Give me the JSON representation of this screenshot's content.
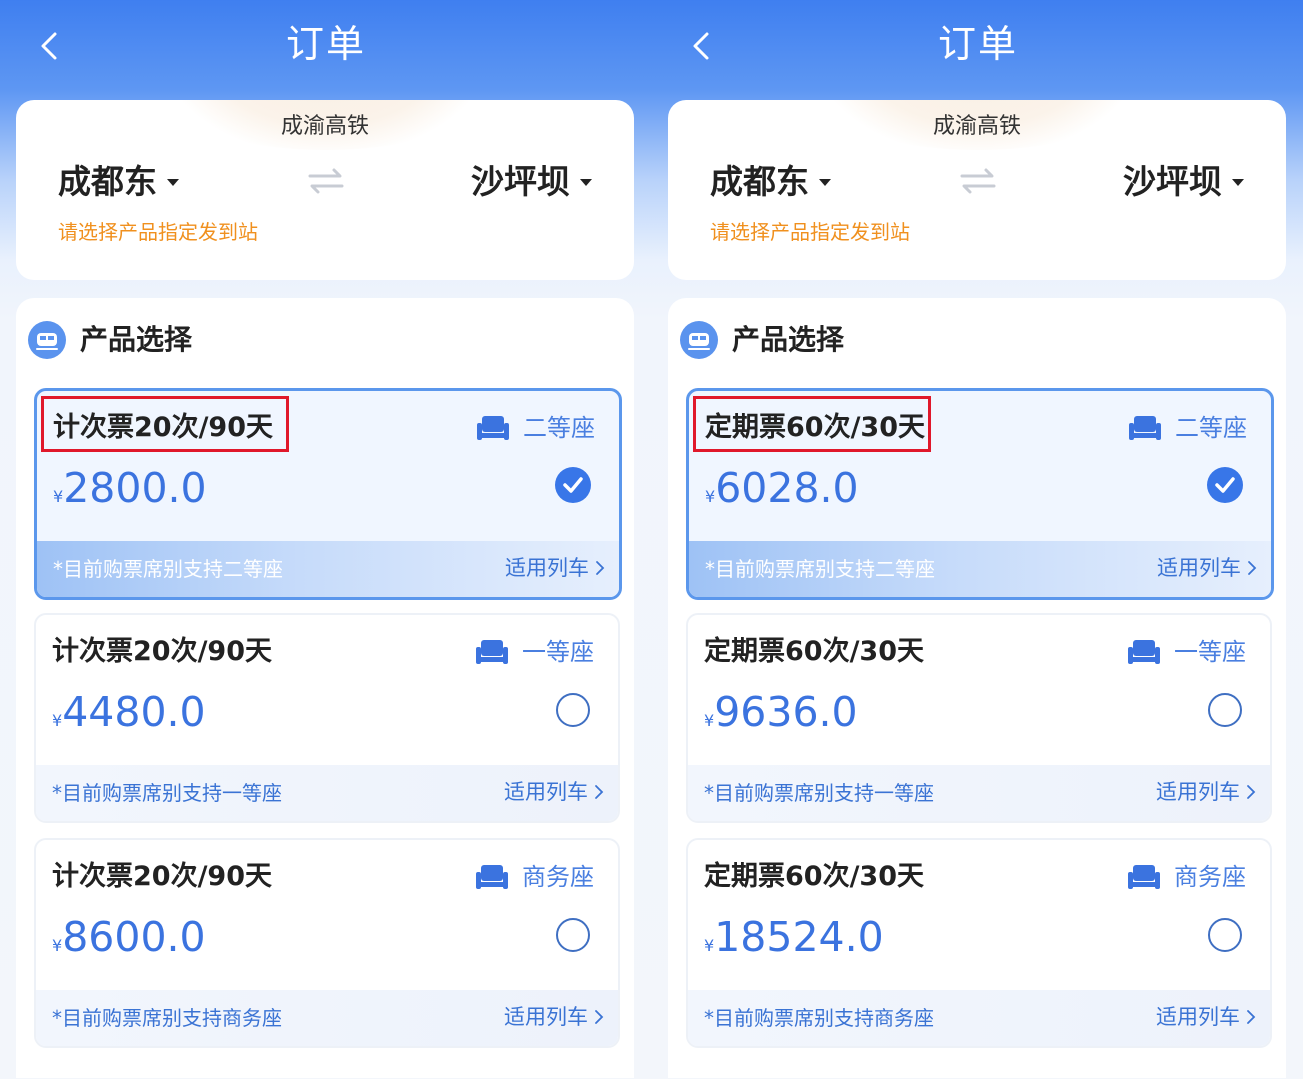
{
  "screens": [
    {
      "nav": {
        "title": "订单"
      },
      "route": {
        "line_name": "成渝高铁",
        "from_station": "成都东",
        "to_station": "沙坪坝",
        "hint": "请选择产品指定发到站"
      },
      "products": {
        "section_title": "产品选择",
        "options": [
          {
            "name": "计次票20次/90天",
            "seat": "二等座",
            "currency": "¥",
            "price": "2800.0",
            "note": "*目前购票席别支持二等座",
            "link": "适用列车",
            "selected": true
          },
          {
            "name": "计次票20次/90天",
            "seat": "一等座",
            "currency": "¥",
            "price": "4480.0",
            "note": "*目前购票席别支持一等座",
            "link": "适用列车",
            "selected": false
          },
          {
            "name": "计次票20次/90天",
            "seat": "商务座",
            "currency": "¥",
            "price": "8600.0",
            "note": "*目前购票席别支持商务座",
            "link": "适用列车",
            "selected": false
          }
        ]
      }
    },
    {
      "nav": {
        "title": "订单"
      },
      "route": {
        "line_name": "成渝高铁",
        "from_station": "成都东",
        "to_station": "沙坪坝",
        "hint": "请选择产品指定发到站"
      },
      "products": {
        "section_title": "产品选择",
        "options": [
          {
            "name": "定期票60次/30天",
            "seat": "二等座",
            "currency": "¥",
            "price": "6028.0",
            "note": "*目前购票席别支持二等座",
            "link": "适用列车",
            "selected": true
          },
          {
            "name": "定期票60次/30天",
            "seat": "一等座",
            "currency": "¥",
            "price": "9636.0",
            "note": "*目前购票席别支持一等座",
            "link": "适用列车",
            "selected": false
          },
          {
            "name": "定期票60次/30天",
            "seat": "商务座",
            "currency": "¥",
            "price": "18524.0",
            "note": "*目前购票席别支持商务座",
            "link": "适用列车",
            "selected": false
          }
        ]
      }
    }
  ],
  "colors": {
    "header_blue": "#3f7ff0",
    "accent_blue": "#3876e8",
    "price_blue": "#3b73df",
    "hint_orange": "#f0901e",
    "highlight_red": "#e0182b"
  },
  "icons": [
    "back-icon",
    "caret-down-icon",
    "swap-icon",
    "train-icon",
    "seat-icon",
    "check-icon",
    "chevron-right-icon"
  ]
}
